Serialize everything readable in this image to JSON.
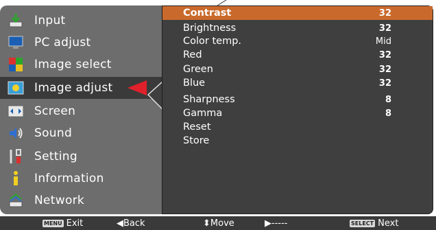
{
  "menu": {
    "items": [
      {
        "label": "Input",
        "icon": "input-icon"
      },
      {
        "label": "PC adjust",
        "icon": "monitor-icon"
      },
      {
        "label": "Image select",
        "icon": "image-select-icon"
      },
      {
        "label": "Image adjust",
        "icon": "image-adjust-icon"
      },
      {
        "label": "Screen",
        "icon": "screen-icon"
      },
      {
        "label": "Sound",
        "icon": "speaker-icon"
      },
      {
        "label": "Setting",
        "icon": "wrench-icon"
      },
      {
        "label": "Information",
        "icon": "info-icon"
      },
      {
        "label": "Network",
        "icon": "network-icon"
      }
    ],
    "active_index": 3
  },
  "settings": {
    "rows": [
      {
        "name": "Contrast",
        "value": "32"
      },
      {
        "name": "Brightness",
        "value": "32"
      },
      {
        "name": "Color temp.",
        "value": "Mid"
      },
      {
        "name": "Red",
        "value": "32"
      },
      {
        "name": "Green",
        "value": "32"
      },
      {
        "name": "Blue",
        "value": "32"
      },
      {
        "name": "Sharpness",
        "value": "8"
      },
      {
        "name": "Gamma",
        "value": "8"
      },
      {
        "name": "Reset",
        "value": ""
      },
      {
        "name": "Store",
        "value": ""
      }
    ],
    "highlight_index": 0
  },
  "footer": {
    "menu_badge": "MENU",
    "exit": "Exit",
    "back": "◀Back",
    "move": "⬍Move",
    "right": "▶-----",
    "select_badge": "SELECT",
    "next": "Next"
  },
  "colors": {
    "highlight": "#c96a2c",
    "active_arrow": "#e0212b",
    "panel_left": "#6d6d6d",
    "panel_right": "#3f3f3f"
  }
}
